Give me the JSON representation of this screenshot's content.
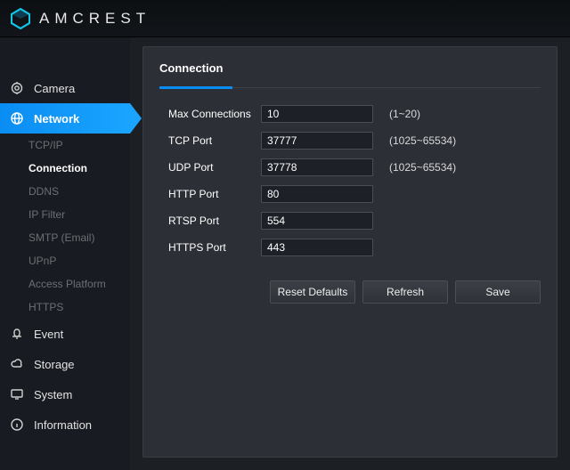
{
  "brand": {
    "name": "AMCREST"
  },
  "sidebar": {
    "items": [
      {
        "label": "Camera"
      },
      {
        "label": "Network"
      },
      {
        "label": "Event"
      },
      {
        "label": "Storage"
      },
      {
        "label": "System"
      },
      {
        "label": "Information"
      }
    ],
    "network_sub": [
      {
        "label": "TCP/IP"
      },
      {
        "label": "Connection"
      },
      {
        "label": "DDNS"
      },
      {
        "label": "IP Filter"
      },
      {
        "label": "SMTP (Email)"
      },
      {
        "label": "UPnP"
      },
      {
        "label": "Access Platform"
      },
      {
        "label": "HTTPS"
      }
    ]
  },
  "panel": {
    "title": "Connection",
    "fields": {
      "max_connections": {
        "label": "Max Connections",
        "value": "10",
        "hint": "(1~20)"
      },
      "tcp_port": {
        "label": "TCP Port",
        "value": "37777",
        "hint": "(1025~65534)"
      },
      "udp_port": {
        "label": "UDP Port",
        "value": "37778",
        "hint": "(1025~65534)"
      },
      "http_port": {
        "label": "HTTP Port",
        "value": "80"
      },
      "rtsp_port": {
        "label": "RTSP Port",
        "value": "554"
      },
      "https_port": {
        "label": "HTTPS Port",
        "value": "443"
      }
    },
    "buttons": {
      "reset": "Reset Defaults",
      "refresh": "Refresh",
      "save": "Save"
    }
  }
}
